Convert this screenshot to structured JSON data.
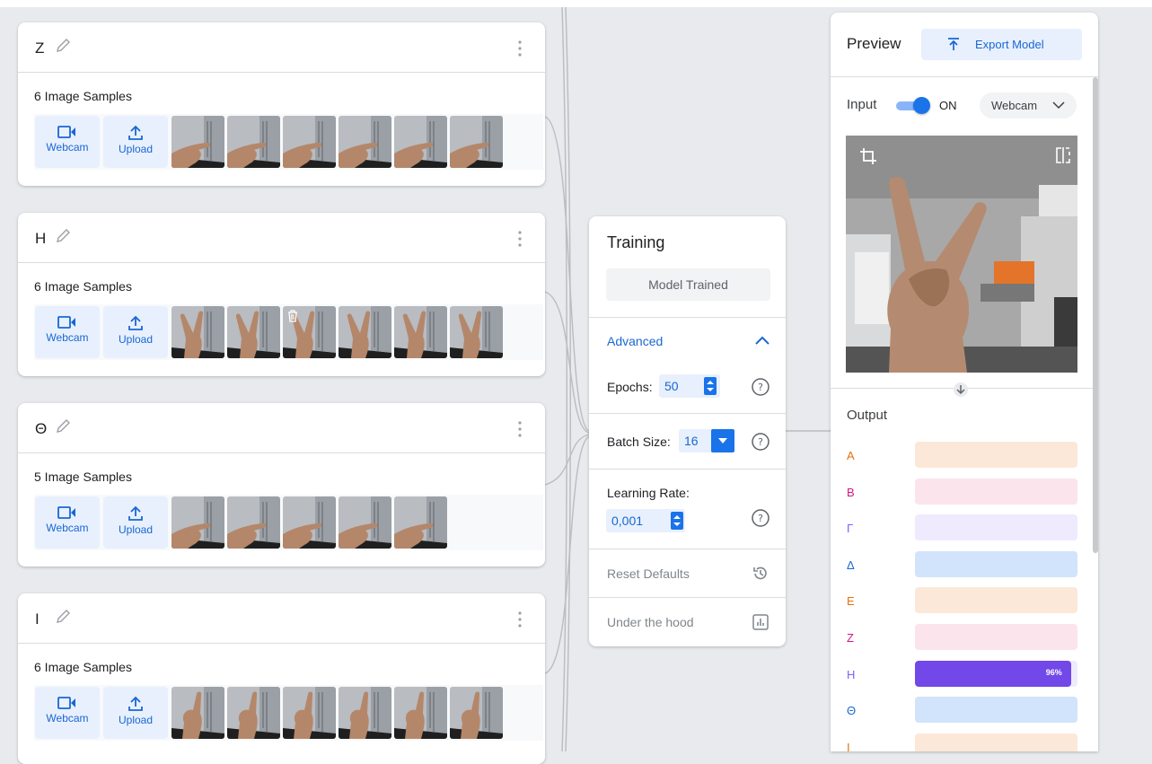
{
  "classes": [
    {
      "name": "Z",
      "samples_label": "6 Image Samples",
      "count": 6,
      "pose": "flat"
    },
    {
      "name": "H",
      "samples_label": "6 Image Samples",
      "count": 6,
      "pose": "vee"
    },
    {
      "name": "Θ",
      "samples_label": "5 Image Samples",
      "count": 5,
      "pose": "flat"
    },
    {
      "name": "I",
      "samples_label": "6 Image Samples",
      "count": 6,
      "pose": "pinky"
    }
  ],
  "source_buttons": {
    "webcam": "Webcam",
    "upload": "Upload"
  },
  "training": {
    "title": "Training",
    "status_button": "Model Trained",
    "advanced_label": "Advanced",
    "epochs_label": "Epochs:",
    "epochs_value": "50",
    "batch_label": "Batch Size:",
    "batch_value": "16",
    "lr_label": "Learning Rate:",
    "lr_value": "0,001",
    "reset_label": "Reset Defaults",
    "hood_label": "Under the hood"
  },
  "preview": {
    "title": "Preview",
    "export_label": "Export Model",
    "input_label": "Input",
    "toggle_state": "ON",
    "source_select": "Webcam",
    "output_label": "Output",
    "outputs": [
      {
        "label": "A",
        "color": "#e8710a",
        "bar": "#fce8d8",
        "value": 0
      },
      {
        "label": "B",
        "color": "#d01884",
        "bar": "#fce4ec",
        "value": 0
      },
      {
        "label": "Γ",
        "color": "#7b61ff",
        "bar": "#efeafd",
        "value": 0
      },
      {
        "label": "Δ",
        "color": "#1967d2",
        "bar": "#d2e3fc",
        "value": 0
      },
      {
        "label": "E",
        "color": "#e8710a",
        "bar": "#fce8d8",
        "value": 0
      },
      {
        "label": "Z",
        "color": "#d01884",
        "bar": "#fce4ec",
        "value": 0
      },
      {
        "label": "H",
        "color": "#7b61ff",
        "bar": "#efeafd",
        "value": 96,
        "fill": "#7248e8",
        "pct": "96%"
      },
      {
        "label": "Θ",
        "color": "#1967d2",
        "bar": "#d2e3fc",
        "value": 0
      },
      {
        "label": "I",
        "color": "#e8710a",
        "bar": "#fce8d8",
        "value": 0
      }
    ]
  },
  "colors": {
    "accent": "#1a73e8",
    "accent_light": "#e8f0fe",
    "background": "#e8eaed"
  }
}
